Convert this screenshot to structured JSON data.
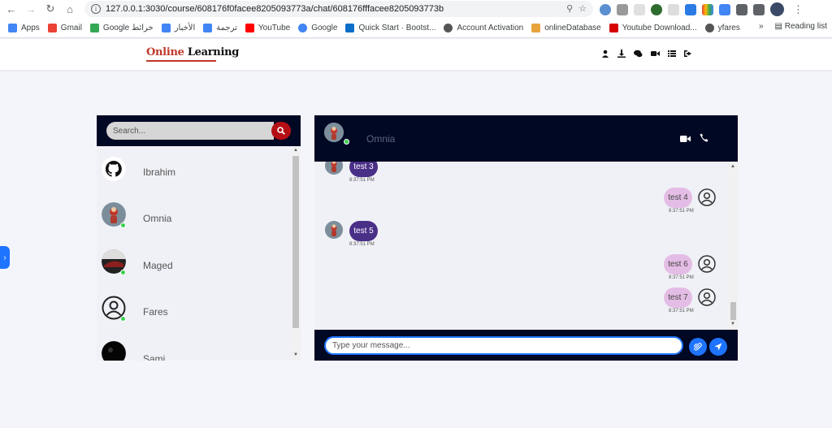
{
  "browser": {
    "url": "127.0.0.1:3030/course/608176f0facee8205093773a/chat/608176fffacee8205093773b",
    "bookmarks": [
      {
        "label": "Apps",
        "color": "#4285f4"
      },
      {
        "label": "Gmail",
        "color": "#ea4335"
      },
      {
        "label": "Google خرائط",
        "color": "#34a853"
      },
      {
        "label": "الأخبار",
        "color": "#4285f4"
      },
      {
        "label": "ترجمة",
        "color": "#4285f4"
      },
      {
        "label": "YouTube",
        "color": "#ff0000"
      },
      {
        "label": "Google",
        "color": "#4285f4"
      },
      {
        "label": "Quick Start · Bootst...",
        "color": "#0b6ec9"
      },
      {
        "label": "Account Activation",
        "color": "#555555"
      },
      {
        "label": "onlineDatabase",
        "color": "#e8a33d"
      },
      {
        "label": "Youtube Download...",
        "color": "#d60000"
      },
      {
        "label": "yfares",
        "color": "#555555"
      }
    ],
    "more": "»",
    "reading_list": "Reading list"
  },
  "app": {
    "logo_part1": "Online ",
    "logo_part2": "Learning"
  },
  "contacts": {
    "search_placeholder": "Search...",
    "items": [
      {
        "name": "Ibrahim",
        "avatar": "github-icon",
        "online": false
      },
      {
        "name": "Omnia",
        "avatar": "photo",
        "online": true
      },
      {
        "name": "Maged",
        "avatar": "photo",
        "online": true
      },
      {
        "name": "Fares",
        "avatar": "user-circle-icon",
        "online": true
      },
      {
        "name": "Sami",
        "avatar": "photo",
        "online": false
      }
    ]
  },
  "chat": {
    "partner_name": "Omnia",
    "messages": [
      {
        "text": "test 3",
        "time": "8:37:51 PM",
        "direction": "in"
      },
      {
        "text": "test 4",
        "time": "8:37:51 PM",
        "direction": "out"
      },
      {
        "text": "test 5",
        "time": "8:37:51 PM",
        "direction": "in"
      },
      {
        "text": "test 6",
        "time": "8:37:51 PM",
        "direction": "out"
      },
      {
        "text": "test 7",
        "time": "8:37:51 PM",
        "direction": "out"
      }
    ],
    "input_placeholder": "Type your message..."
  },
  "colors": {
    "navy": "#010824",
    "incoming_bubble": "#4a2f87",
    "outgoing_bubble": "#e4bde6",
    "accent_blue": "#1e73ff",
    "search_red": "#b40f15",
    "online_green": "#3ad14f"
  }
}
